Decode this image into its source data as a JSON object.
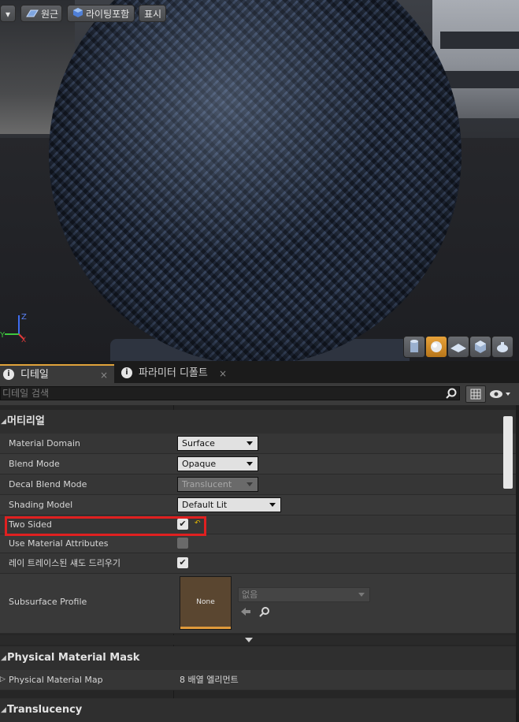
{
  "viewport": {
    "toolbar": {
      "menu_label": "▾",
      "perspective_label": "원근",
      "lighting_label": "라이팅포함",
      "show_label": "표시"
    },
    "axis": {
      "z": "Z",
      "y": "Y",
      "x": "X"
    },
    "preview_shapes": [
      "cylinder-icon",
      "sphere-icon",
      "plane-icon",
      "cube-icon",
      "teapot-icon"
    ],
    "active_shape": "sphere-icon"
  },
  "tabs": [
    {
      "label": "디테일",
      "close": "×",
      "active": true
    },
    {
      "label": "파라미터 디폴트",
      "close": "×",
      "active": false
    }
  ],
  "search": {
    "placeholder": "디테일 검색"
  },
  "details": {
    "category_material": "머티리얼",
    "rows": {
      "material_domain": {
        "label": "Material Domain",
        "value": "Surface"
      },
      "blend_mode": {
        "label": "Blend Mode",
        "value": "Opaque"
      },
      "decal_blend_mode": {
        "label": "Decal Blend Mode",
        "value": "Translucent"
      },
      "shading_model": {
        "label": "Shading Model",
        "value": "Default Lit"
      },
      "two_sided": {
        "label": "Two Sided",
        "checked": true,
        "check_glyph": "✔",
        "reset_glyph": "↶"
      },
      "use_material_attributes": {
        "label": "Use Material Attributes",
        "checked": false
      },
      "ray_traced_shadows": {
        "label": "레이 트레이스된 섀도 드리우기",
        "checked": true,
        "check_glyph": "✔"
      },
      "subsurface_profile": {
        "label": "Subsurface Profile",
        "thumb_text": "None",
        "asset_value": "없음"
      }
    },
    "category_physical_mask": "Physical Material Mask",
    "physical_material_map": {
      "label": "Physical Material Map",
      "value": "8 배열 엘리먼트"
    },
    "category_translucency": "Translucency"
  },
  "colors": {
    "accent": "#e0a33a",
    "highlight_box": "#e02020",
    "panel_bg": "#262626",
    "row_bg": "#363636"
  }
}
